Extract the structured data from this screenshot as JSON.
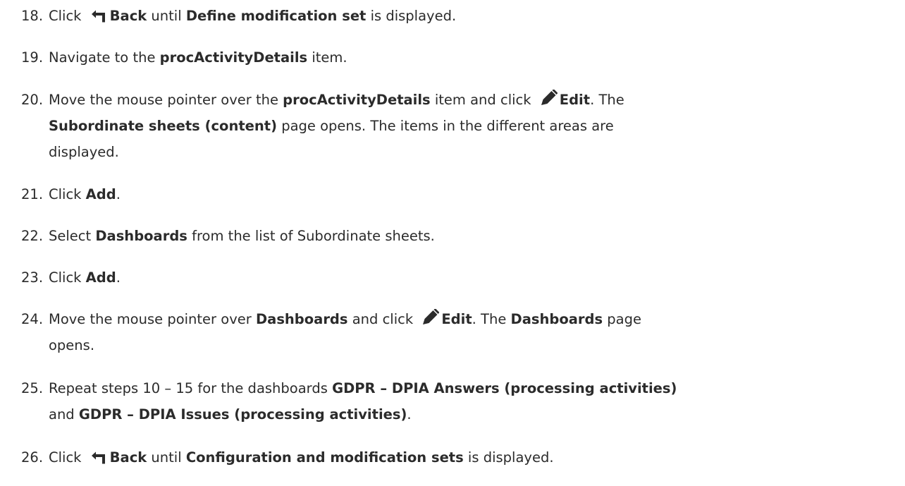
{
  "steps": [
    {
      "number": "18.",
      "lines": [
        [
          {
            "t": "Click "
          },
          {
            "icon": "back-icon"
          },
          {
            "t": "Back",
            "b": true
          },
          {
            "t": " until "
          },
          {
            "t": "Define modification set",
            "b": true
          },
          {
            "t": " is displayed."
          }
        ]
      ]
    },
    {
      "number": "19.",
      "lines": [
        [
          {
            "t": "Navigate to the "
          },
          {
            "t": "procActivityDetails",
            "b": true
          },
          {
            "t": " item."
          }
        ]
      ]
    },
    {
      "number": "20.",
      "lines": [
        [
          {
            "t": "Move the mouse pointer over the "
          },
          {
            "t": "procActivityDetails",
            "b": true
          },
          {
            "t": " item and click "
          },
          {
            "icon": "edit-icon"
          },
          {
            "t": "Edit",
            "b": true
          },
          {
            "t": ". The"
          }
        ],
        [
          {
            "t": "Subordinate sheets (content)",
            "b": true
          },
          {
            "t": " page opens. The items in the different areas are"
          }
        ],
        [
          {
            "t": "displayed."
          }
        ]
      ]
    },
    {
      "number": "21.",
      "lines": [
        [
          {
            "t": "Click "
          },
          {
            "t": "Add",
            "b": true
          },
          {
            "t": "."
          }
        ]
      ]
    },
    {
      "number": "22.",
      "lines": [
        [
          {
            "t": "Select "
          },
          {
            "t": "Dashboards",
            "b": true
          },
          {
            "t": " from the list of Subordinate sheets."
          }
        ]
      ]
    },
    {
      "number": "23.",
      "lines": [
        [
          {
            "t": "Click "
          },
          {
            "t": "Add",
            "b": true
          },
          {
            "t": "."
          }
        ]
      ]
    },
    {
      "number": "24.",
      "lines": [
        [
          {
            "t": "Move the mouse pointer over "
          },
          {
            "t": "Dashboards",
            "b": true
          },
          {
            "t": " and click "
          },
          {
            "icon": "edit-icon"
          },
          {
            "t": "Edit",
            "b": true
          },
          {
            "t": ". The "
          },
          {
            "t": "Dashboards",
            "b": true
          },
          {
            "t": " page"
          }
        ],
        [
          {
            "t": "opens."
          }
        ]
      ]
    },
    {
      "number": "25.",
      "lines": [
        [
          {
            "t": "Repeat steps 10 – 15 for the dashboards "
          },
          {
            "t": "GDPR – DPIA Answers (processing activities)",
            "b": true
          }
        ],
        [
          {
            "t": "and "
          },
          {
            "t": "GDPR – DPIA Issues (processing activities)",
            "b": true
          },
          {
            "t": "."
          }
        ]
      ]
    },
    {
      "number": "26.",
      "lines": [
        [
          {
            "t": "Click "
          },
          {
            "icon": "back-icon"
          },
          {
            "t": "Back",
            "b": true
          },
          {
            "t": " until "
          },
          {
            "t": "Configuration and modification sets",
            "b": true
          },
          {
            "t": " is displayed."
          }
        ]
      ]
    }
  ]
}
